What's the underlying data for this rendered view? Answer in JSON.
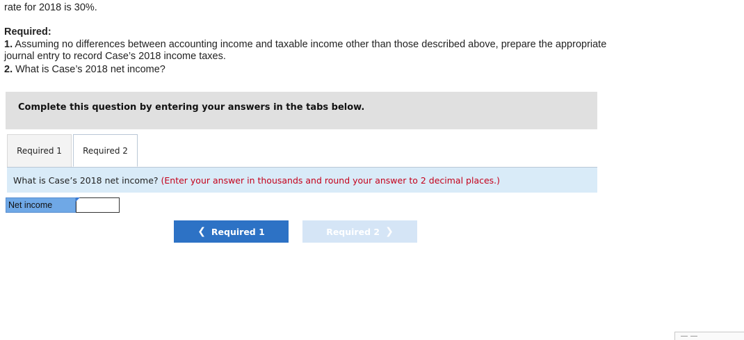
{
  "problem": {
    "intro": "rate for 2018 is 30%.",
    "required_heading": "Required:",
    "items": [
      {
        "num": "1.",
        "text": "Assuming no differences between accounting income and taxable income other than those described above, prepare the appropriate journal entry to record Case’s 2018 income taxes."
      },
      {
        "num": "2.",
        "text": "What is Case’s 2018 net income?"
      }
    ]
  },
  "banner": "Complete this question by entering your answers in the tabs below.",
  "tabs": [
    {
      "label": "Required 1",
      "active": false
    },
    {
      "label": "Required 2",
      "active": true
    }
  ],
  "question": {
    "text": "What is Case’s 2018 net income?",
    "hint": "(Enter your answer in thousands and round your answer to 2 decimal places.)"
  },
  "answer": {
    "label": "Net income",
    "value": ""
  },
  "nav": {
    "prev_label": "Required 1",
    "next_label": "Required 2"
  },
  "colors": {
    "nav_active": "#2d72c5",
    "nav_disabled": "#d5e5f6",
    "hint_red": "#c4001a",
    "question_bg": "#d9ebf8"
  }
}
